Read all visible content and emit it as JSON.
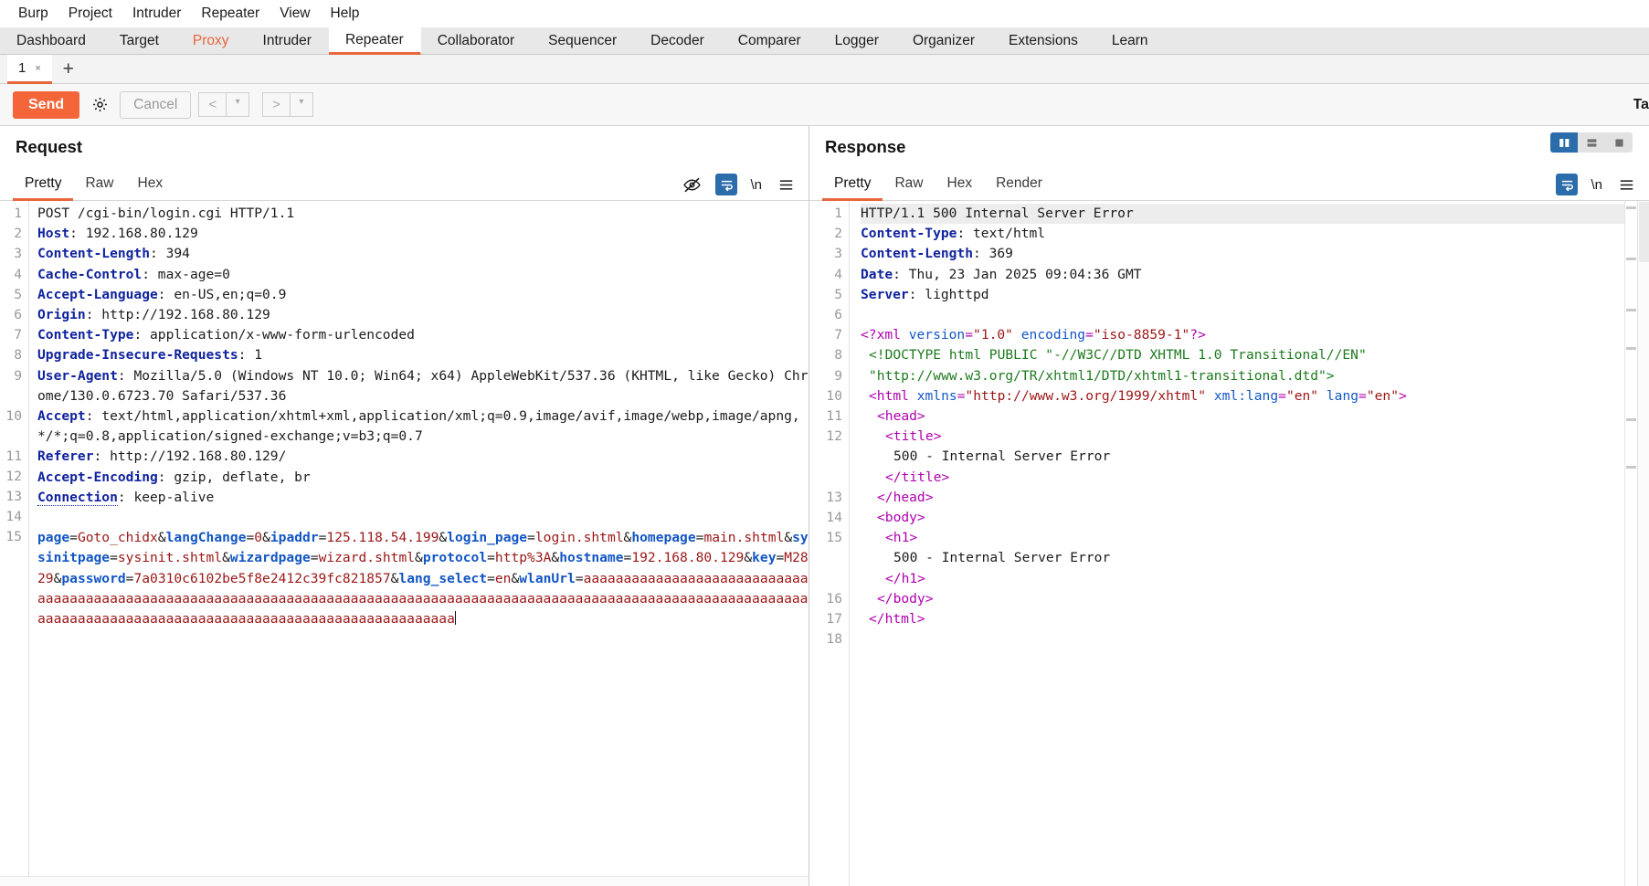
{
  "menubar": {
    "items": [
      "Burp",
      "Project",
      "Intruder",
      "Repeater",
      "View",
      "Help"
    ]
  },
  "main_tabs": {
    "items": [
      {
        "label": "Dashboard",
        "state": "normal"
      },
      {
        "label": "Target",
        "state": "normal"
      },
      {
        "label": "Proxy",
        "state": "highlight"
      },
      {
        "label": "Intruder",
        "state": "normal"
      },
      {
        "label": "Repeater",
        "state": "active"
      },
      {
        "label": "Collaborator",
        "state": "normal"
      },
      {
        "label": "Sequencer",
        "state": "normal"
      },
      {
        "label": "Decoder",
        "state": "normal"
      },
      {
        "label": "Comparer",
        "state": "normal"
      },
      {
        "label": "Logger",
        "state": "normal"
      },
      {
        "label": "Organizer",
        "state": "normal"
      },
      {
        "label": "Extensions",
        "state": "normal"
      },
      {
        "label": "Learn",
        "state": "normal"
      }
    ]
  },
  "repeater_tabs": {
    "tab_label": "1",
    "close_glyph": "×",
    "add_glyph": "+"
  },
  "toolbar": {
    "send_label": "Send",
    "settings_icon": "gear-icon",
    "cancel_label": "Cancel",
    "prev_glyph": "<",
    "next_glyph": ">",
    "caret_glyph": "▾",
    "target_label": "Ta"
  },
  "request": {
    "title": "Request",
    "tabs": [
      {
        "label": "Pretty",
        "active": true
      },
      {
        "label": "Raw",
        "active": false
      },
      {
        "label": "Hex",
        "active": false
      }
    ],
    "icons": [
      {
        "name": "eye-slash-icon",
        "active": false
      },
      {
        "name": "word-wrap-icon",
        "active": true
      },
      {
        "name": "newline-icon",
        "active": false,
        "label": "\\n"
      },
      {
        "name": "menu-icon",
        "active": false
      }
    ],
    "lines": [
      {
        "n": "1",
        "tokens": [
          {
            "c": "t-plain",
            "t": "POST /cgi-bin/login.cgi HTTP/1.1"
          }
        ]
      },
      {
        "n": "2",
        "tokens": [
          {
            "c": "t-hdr",
            "t": "Host"
          },
          {
            "c": "t-plain",
            "t": ": 192.168.80.129"
          }
        ]
      },
      {
        "n": "3",
        "tokens": [
          {
            "c": "t-hdr",
            "t": "Content-Length"
          },
          {
            "c": "t-plain",
            "t": ": 394"
          }
        ]
      },
      {
        "n": "4",
        "tokens": [
          {
            "c": "t-hdr",
            "t": "Cache-Control"
          },
          {
            "c": "t-plain",
            "t": ": max-age=0"
          }
        ]
      },
      {
        "n": "5",
        "tokens": [
          {
            "c": "t-hdr",
            "t": "Accept-Language"
          },
          {
            "c": "t-plain",
            "t": ": en-US,en;q=0.9"
          }
        ]
      },
      {
        "n": "6",
        "tokens": [
          {
            "c": "t-hdr",
            "t": "Origin"
          },
          {
            "c": "t-plain",
            "t": ": http://192.168.80.129"
          }
        ]
      },
      {
        "n": "7",
        "tokens": [
          {
            "c": "t-hdr",
            "t": "Content-Type"
          },
          {
            "c": "t-plain",
            "t": ": application/x-www-form-urlencoded"
          }
        ]
      },
      {
        "n": "8",
        "tokens": [
          {
            "c": "t-hdr",
            "t": "Upgrade-Insecure-Requests"
          },
          {
            "c": "t-plain",
            "t": ": 1"
          }
        ]
      },
      {
        "n": "9",
        "tokens": [
          {
            "c": "t-hdr",
            "t": "User-Agent"
          },
          {
            "c": "t-plain",
            "t": ": Mozilla/5.0 (Windows NT 10.0; Win64; x64) AppleWebKit/537.36 (KHTML, like Gecko) Chrome/130.0.6723.70 Safari/537.36"
          }
        ]
      },
      {
        "n": "10",
        "tokens": [
          {
            "c": "t-hdr",
            "t": "Accept"
          },
          {
            "c": "t-plain",
            "t": ": text/html,application/xhtml+xml,application/xml;q=0.9,image/avif,image/webp,image/apng,*/*;q=0.8,application/signed-exchange;v=b3;q=0.7"
          }
        ]
      },
      {
        "n": "11",
        "tokens": [
          {
            "c": "t-hdr",
            "t": "Referer"
          },
          {
            "c": "t-plain",
            "t": ": http://192.168.80.129/"
          }
        ]
      },
      {
        "n": "12",
        "tokens": [
          {
            "c": "t-hdr",
            "t": "Accept-Encoding"
          },
          {
            "c": "t-plain",
            "t": ": gzip, deflate, br"
          }
        ]
      },
      {
        "n": "13",
        "tokens": [
          {
            "c": "t-hdru",
            "t": "Connection"
          },
          {
            "c": "t-plain",
            "t": ": keep-alive"
          }
        ]
      },
      {
        "n": "14",
        "tokens": []
      },
      {
        "n": "15",
        "tokens": [
          {
            "c": "t-key",
            "t": "page"
          },
          {
            "c": "t-amp",
            "t": "="
          },
          {
            "c": "t-val",
            "t": "Goto_chidx"
          },
          {
            "c": "t-amp",
            "t": "&"
          },
          {
            "c": "t-key",
            "t": "langChange"
          },
          {
            "c": "t-amp",
            "t": "="
          },
          {
            "c": "t-val",
            "t": "0"
          },
          {
            "c": "t-amp",
            "t": "&"
          },
          {
            "c": "t-key",
            "t": "ipaddr"
          },
          {
            "c": "t-amp",
            "t": "="
          },
          {
            "c": "t-val",
            "t": "125.118.54.199"
          },
          {
            "c": "t-amp",
            "t": "&"
          },
          {
            "c": "t-key",
            "t": "login_page"
          },
          {
            "c": "t-amp",
            "t": "="
          },
          {
            "c": "t-val",
            "t": "login.shtml"
          },
          {
            "c": "t-amp",
            "t": "&"
          },
          {
            "c": "t-key",
            "t": "homepage"
          },
          {
            "c": "t-amp",
            "t": "="
          },
          {
            "c": "t-val",
            "t": "main.shtml"
          },
          {
            "c": "t-amp",
            "t": "&"
          },
          {
            "c": "t-key",
            "t": "sysinitpage"
          },
          {
            "c": "t-amp",
            "t": "="
          },
          {
            "c": "t-val",
            "t": "sysinit.shtml"
          },
          {
            "c": "t-amp",
            "t": "&"
          },
          {
            "c": "t-key",
            "t": "wizardpage"
          },
          {
            "c": "t-amp",
            "t": "="
          },
          {
            "c": "t-val",
            "t": "wizard.shtml"
          },
          {
            "c": "t-amp",
            "t": "&"
          },
          {
            "c": "t-key",
            "t": "protocol"
          },
          {
            "c": "t-amp",
            "t": "="
          },
          {
            "c": "t-val",
            "t": "http%3A"
          },
          {
            "c": "t-amp",
            "t": "&"
          },
          {
            "c": "t-key",
            "t": "hostname"
          },
          {
            "c": "t-amp",
            "t": "="
          },
          {
            "c": "t-val",
            "t": "192.168.80.129"
          },
          {
            "c": "t-amp",
            "t": "&"
          },
          {
            "c": "t-key",
            "t": "key"
          },
          {
            "c": "t-amp",
            "t": "="
          },
          {
            "c": "t-val",
            "t": "M2829"
          },
          {
            "c": "t-amp",
            "t": "&"
          },
          {
            "c": "t-key",
            "t": "password"
          },
          {
            "c": "t-amp",
            "t": "="
          },
          {
            "c": "t-val",
            "t": "7a0310c6102be5f8e2412c39fc821857"
          },
          {
            "c": "t-amp",
            "t": "&"
          },
          {
            "c": "t-key",
            "t": "lang_select"
          },
          {
            "c": "t-amp",
            "t": "="
          },
          {
            "c": "t-val",
            "t": "en"
          },
          {
            "c": "t-amp",
            "t": "&"
          },
          {
            "c": "t-key",
            "t": "wlanUrl"
          },
          {
            "c": "t-amp",
            "t": "="
          },
          {
            "c": "t-val",
            "t": "aaaaaaaaaaaaaaaaaaaaaaaaaaaaaaaaaaaaaaaaaaaaaaaaaaaaaaaaaaaaaaaaaaaaaaaaaaaaaaaaaaaaaaaaaaaaaaaaaaaaaaaaaaaaaaaaaaaaaaaaaaaaaaaaaaaaaaaaaaaaaaaaaaaaaaaaaaaaaaaaaaaaaaaaaaaaaaaa"
          }
        ]
      }
    ]
  },
  "response": {
    "title": "Response",
    "tabs": [
      {
        "label": "Pretty",
        "active": true
      },
      {
        "label": "Raw",
        "active": false
      },
      {
        "label": "Hex",
        "active": false
      },
      {
        "label": "Render",
        "active": false
      }
    ],
    "view_buttons": [
      {
        "name": "split-vertical-view",
        "active": true
      },
      {
        "name": "split-horizontal-view",
        "active": false
      },
      {
        "name": "single-pane-view",
        "active": false
      }
    ],
    "icons": [
      {
        "name": "word-wrap-icon",
        "active": true
      },
      {
        "name": "newline-icon",
        "active": false,
        "label": "\\n"
      },
      {
        "name": "menu-icon",
        "active": false
      }
    ],
    "lines": [
      {
        "n": "1",
        "hl": true,
        "tokens": [
          {
            "c": "t-plain",
            "t": "HTTP/1.1 500 Internal Server Error"
          }
        ]
      },
      {
        "n": "2",
        "tokens": [
          {
            "c": "t-hdr",
            "t": "Content-Type"
          },
          {
            "c": "t-plain",
            "t": ": text/html"
          }
        ]
      },
      {
        "n": "3",
        "tokens": [
          {
            "c": "t-hdr",
            "t": "Content-Length"
          },
          {
            "c": "t-plain",
            "t": ": 369"
          }
        ]
      },
      {
        "n": "4",
        "tokens": [
          {
            "c": "t-hdr",
            "t": "Date"
          },
          {
            "c": "t-plain",
            "t": ": Thu, 23 Jan 2025 09:04:36 GMT"
          }
        ]
      },
      {
        "n": "5",
        "tokens": [
          {
            "c": "t-hdr",
            "t": "Server"
          },
          {
            "c": "t-plain",
            "t": ": lighttpd"
          }
        ]
      },
      {
        "n": "6",
        "tokens": []
      },
      {
        "n": "7",
        "tokens": [
          {
            "c": "t-pi",
            "t": "<?xml "
          },
          {
            "c": "t-attr",
            "t": "version"
          },
          {
            "c": "t-pi",
            "t": "="
          },
          {
            "c": "t-str",
            "t": "\"1.0\""
          },
          {
            "c": "t-pi",
            "t": " "
          },
          {
            "c": "t-attr",
            "t": "encoding"
          },
          {
            "c": "t-pi",
            "t": "="
          },
          {
            "c": "t-str",
            "t": "\"iso-8859-1\""
          },
          {
            "c": "t-pi",
            "t": "?>"
          }
        ]
      },
      {
        "n": "8",
        "indent": 1,
        "tokens": [
          {
            "c": "t-dtd",
            "t": "<!DOCTYPE html PUBLIC \"-//W3C//DTD XHTML 1.0 Transitional//EN\""
          }
        ]
      },
      {
        "n": "9",
        "indent": 1,
        "tokens": [
          {
            "c": "t-dtd",
            "t": "\"http://www.w3.org/TR/xhtml1/DTD/xhtml1-transitional.dtd\">"
          }
        ]
      },
      {
        "n": "10",
        "indent": 1,
        "tokens": [
          {
            "c": "t-tag",
            "t": "<html "
          },
          {
            "c": "t-attr",
            "t": "xmlns"
          },
          {
            "c": "t-tag",
            "t": "="
          },
          {
            "c": "t-str",
            "t": "\"http://www.w3.org/1999/xhtml\""
          },
          {
            "c": "t-tag",
            "t": " "
          },
          {
            "c": "t-attr",
            "t": "xml:lang"
          },
          {
            "c": "t-tag",
            "t": "="
          },
          {
            "c": "t-str",
            "t": "\"en\""
          },
          {
            "c": "t-tag",
            "t": " "
          },
          {
            "c": "t-attr",
            "t": "lang"
          },
          {
            "c": "t-tag",
            "t": "="
          },
          {
            "c": "t-str",
            "t": "\"en\""
          },
          {
            "c": "t-tag",
            "t": ">"
          }
        ]
      },
      {
        "n": "11",
        "indent": 2,
        "tokens": [
          {
            "c": "t-tag",
            "t": "<head>"
          }
        ]
      },
      {
        "n": "12",
        "indent": 3,
        "tokens": [
          {
            "c": "t-tag",
            "t": "<title>"
          }
        ]
      },
      {
        "n": "",
        "indent": 4,
        "tokens": [
          {
            "c": "t-txt",
            "t": "500 - Internal Server Error"
          }
        ]
      },
      {
        "n": "",
        "indent": 3,
        "tokens": [
          {
            "c": "t-tag",
            "t": "</title>"
          }
        ]
      },
      {
        "n": "13",
        "indent": 2,
        "tokens": [
          {
            "c": "t-tag",
            "t": "</head>"
          }
        ]
      },
      {
        "n": "14",
        "indent": 2,
        "tokens": [
          {
            "c": "t-tag",
            "t": "<body>"
          }
        ]
      },
      {
        "n": "15",
        "indent": 3,
        "tokens": [
          {
            "c": "t-tag",
            "t": "<h1>"
          }
        ]
      },
      {
        "n": "",
        "indent": 4,
        "tokens": [
          {
            "c": "t-txt",
            "t": "500 - Internal Server Error"
          }
        ]
      },
      {
        "n": "",
        "indent": 3,
        "tokens": [
          {
            "c": "t-tag",
            "t": "</h1>"
          }
        ]
      },
      {
        "n": "16",
        "indent": 2,
        "tokens": [
          {
            "c": "t-tag",
            "t": "</body>"
          }
        ]
      },
      {
        "n": "17",
        "indent": 1,
        "tokens": [
          {
            "c": "t-tag",
            "t": "</html>"
          }
        ]
      },
      {
        "n": "18",
        "tokens": []
      }
    ]
  },
  "colors": {
    "accent": "#e8663c",
    "send_button": "#f4663a",
    "active_blue": "#2b6cab",
    "header_blue": "#10239e",
    "value_red": "#9c1616",
    "tag_magenta": "#b000b0",
    "dtd_green": "#1d7a1d"
  }
}
